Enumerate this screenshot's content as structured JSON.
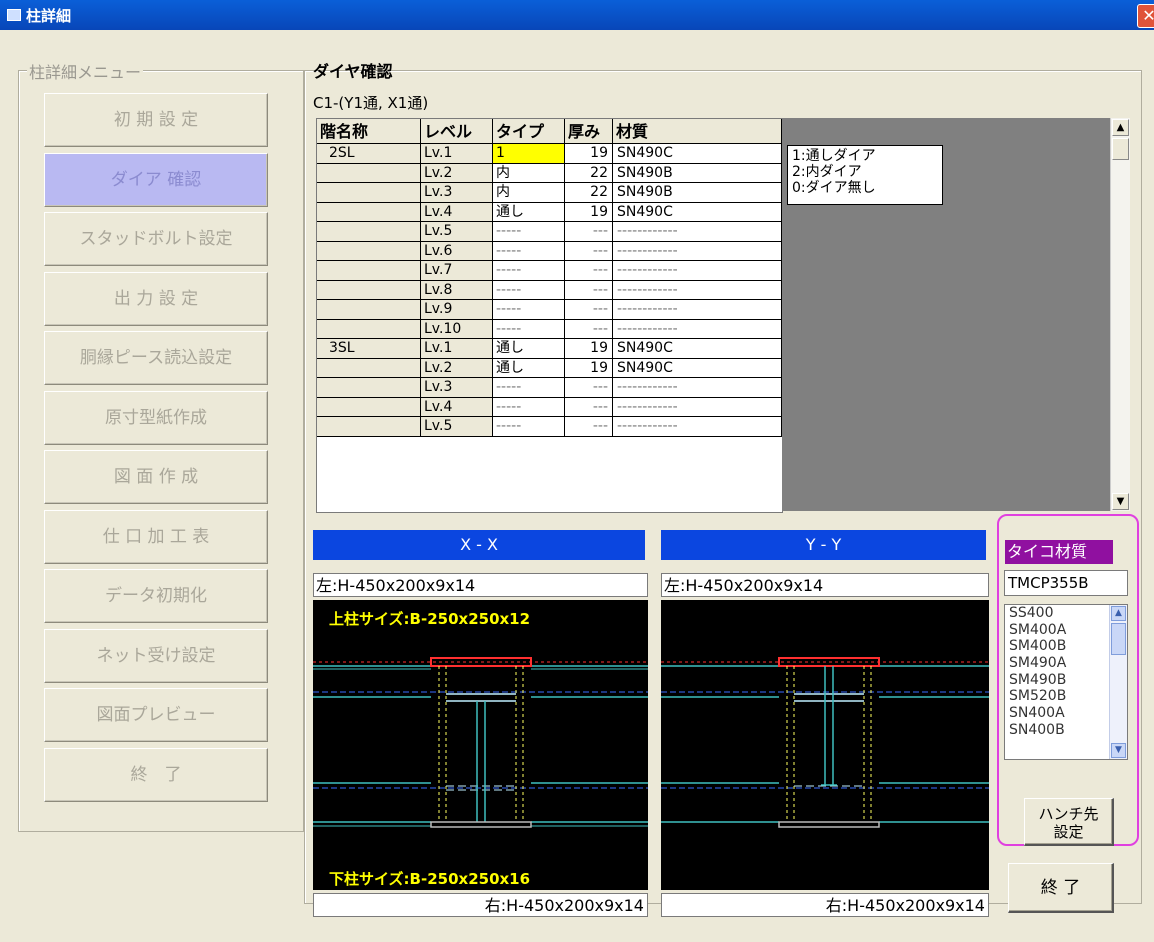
{
  "window": {
    "title": "柱詳細",
    "close_glyph": "✕"
  },
  "menu": {
    "group_label": "柱詳細メニュー",
    "items": [
      {
        "label": "初 期 設 定"
      },
      {
        "label": "ダイア 確認",
        "active": true
      },
      {
        "label": "スタッドボルト設定"
      },
      {
        "label": "出 力 設 定"
      },
      {
        "label": "胴縁ピース読込設定"
      },
      {
        "label": "原寸型紙作成"
      },
      {
        "label": "図 面 作 成"
      },
      {
        "label": "仕 口 加 工 表"
      },
      {
        "label": "データ初期化"
      },
      {
        "label": "ネット受け設定"
      },
      {
        "label": "図面プレビュー"
      },
      {
        "label": "終　了"
      }
    ]
  },
  "diaphragm": {
    "group_label": "ダイヤ確認",
    "subtitle": "C1-(Y1通, X1通)",
    "headers": [
      "階名称",
      "レベル",
      "タイプ",
      "厚み",
      "材質"
    ],
    "rows": [
      {
        "floor": "2SL",
        "level": "Lv.1",
        "type": "1",
        "thickness": "19",
        "material": "SN490C"
      },
      {
        "floor": "",
        "level": "Lv.2",
        "type": "内",
        "thickness": "22",
        "material": "SN490B"
      },
      {
        "floor": "",
        "level": "Lv.3",
        "type": "内",
        "thickness": "22",
        "material": "SN490B"
      },
      {
        "floor": "",
        "level": "Lv.4",
        "type": "通し",
        "thickness": "19",
        "material": "SN490C"
      },
      {
        "floor": "",
        "level": "Lv.5",
        "type": "-----",
        "thickness": "---",
        "material": "------------"
      },
      {
        "floor": "",
        "level": "Lv.6",
        "type": "-----",
        "thickness": "---",
        "material": "------------"
      },
      {
        "floor": "",
        "level": "Lv.7",
        "type": "-----",
        "thickness": "---",
        "material": "------------"
      },
      {
        "floor": "",
        "level": "Lv.8",
        "type": "-----",
        "thickness": "---",
        "material": "------------"
      },
      {
        "floor": "",
        "level": "Lv.9",
        "type": "-----",
        "thickness": "---",
        "material": "------------"
      },
      {
        "floor": "",
        "level": "Lv.10",
        "type": "-----",
        "thickness": "---",
        "material": "------------"
      },
      {
        "floor": "3SL",
        "level": "Lv.1",
        "type": "通し",
        "thickness": "19",
        "material": "SN490C"
      },
      {
        "floor": "",
        "level": "Lv.2",
        "type": "通し",
        "thickness": "19",
        "material": "SN490C"
      },
      {
        "floor": "",
        "level": "Lv.3",
        "type": "-----",
        "thickness": "---",
        "material": "------------"
      },
      {
        "floor": "",
        "level": "Lv.4",
        "type": "-----",
        "thickness": "---",
        "material": "------------"
      },
      {
        "floor": "",
        "level": "Lv.5",
        "type": "-----",
        "thickness": "---",
        "material": "------------"
      }
    ],
    "legend": [
      "1:通しダイア",
      "2:内ダイア",
      "0:ダイア無し"
    ]
  },
  "views": {
    "xx": {
      "header": "X - X",
      "left_size": "左:H-450x200x9x14",
      "right_size": "右:H-450x200x9x14",
      "upper_column": "上柱サイズ:B-250x250x12",
      "lower_column": "下柱サイズ:B-250x250x16"
    },
    "yy": {
      "header": "Y - Y",
      "left_size": "左:H-450x200x9x14",
      "right_size": "右:H-450x200x9x14"
    }
  },
  "material_panel": {
    "label": "タイコ材質",
    "value": "TMCP355B",
    "options": [
      "SS400",
      "SM400A",
      "SM400B",
      "SM490A",
      "SM490B",
      "SM520B",
      "SN400A",
      "SN400B"
    ]
  },
  "buttons": {
    "haunch_line1": "ハンチ先",
    "haunch_line2": "設定",
    "exit": "終 了"
  },
  "colors": {
    "title_bar": "#0a5fd8",
    "header_bar": "#0b46e0",
    "selected_cell": "#ffff00",
    "material_label_bg": "#9010a0",
    "highlight_border": "#e040e0",
    "active_menu_bg": "#b9b9f2"
  }
}
